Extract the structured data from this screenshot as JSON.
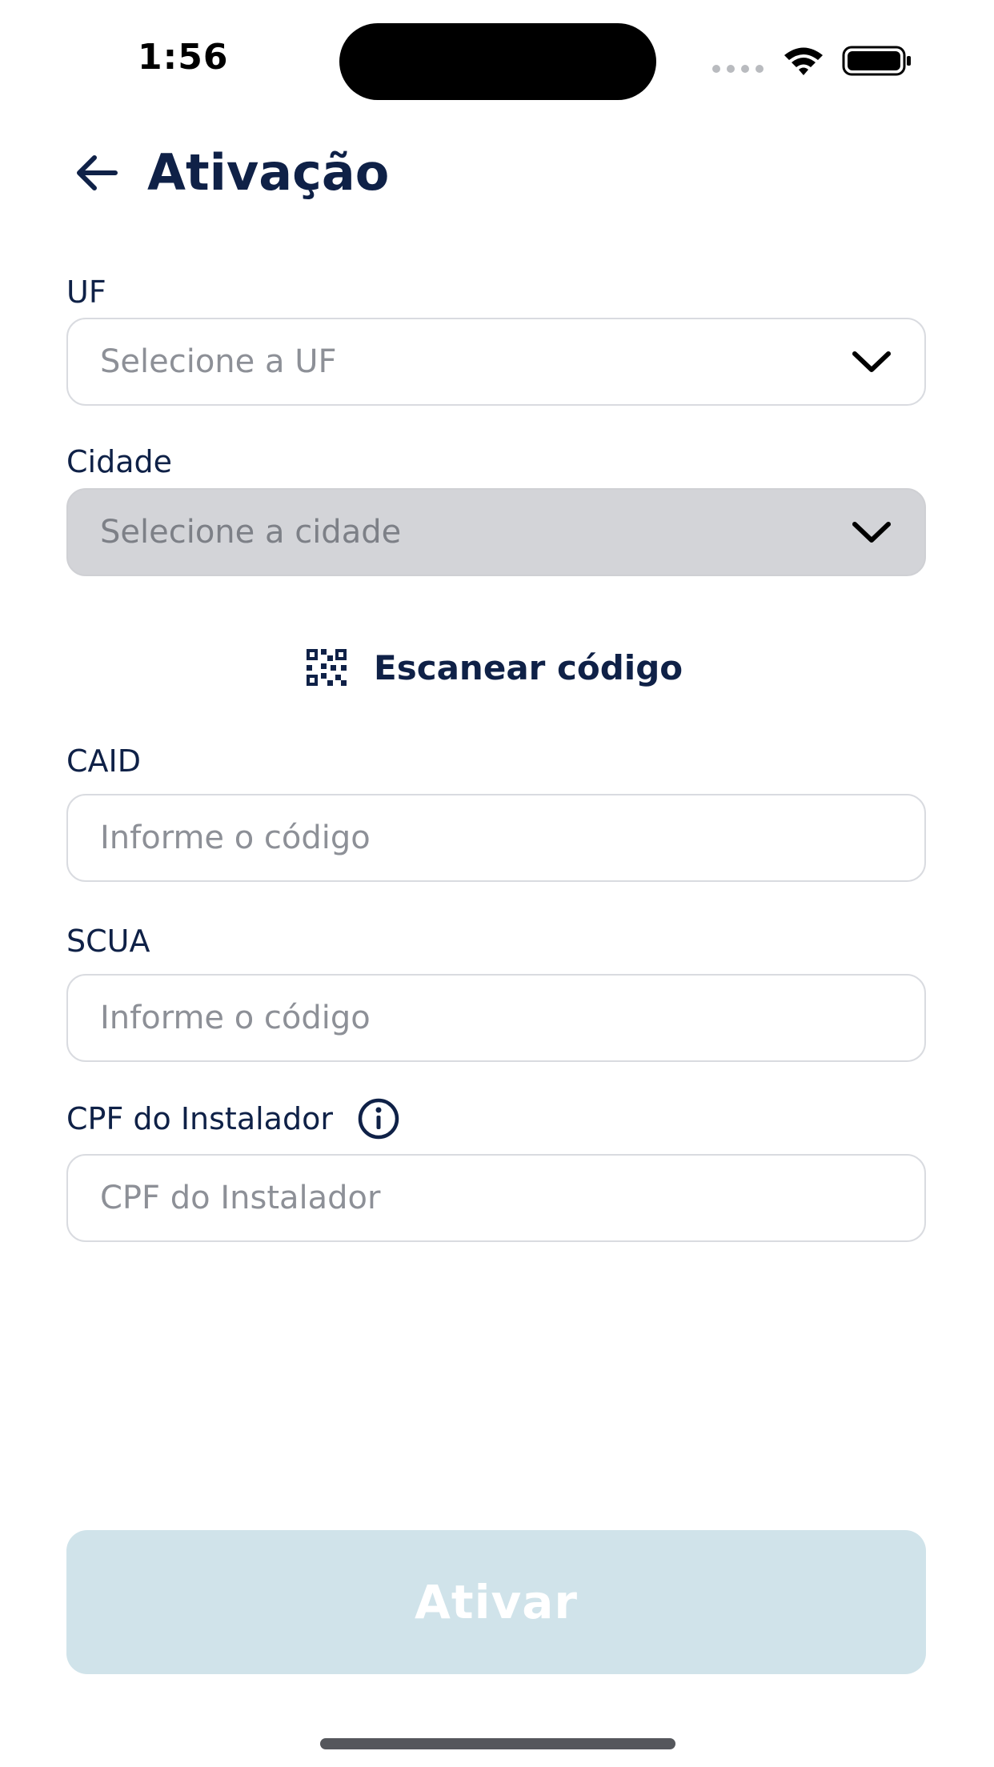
{
  "status_bar": {
    "time": "1:56"
  },
  "header": {
    "title": "Ativação",
    "back_icon": "arrow-left-icon"
  },
  "form": {
    "uf": {
      "label": "UF",
      "placeholder": "Selecione a UF",
      "icon": "chevron-down-icon"
    },
    "cidade": {
      "label": "Cidade",
      "placeholder": "Selecione a cidade",
      "icon": "chevron-down-icon",
      "disabled": true
    },
    "scan": {
      "label": "Escanear código",
      "icon": "qr-code-icon"
    },
    "caid": {
      "label": "CAID",
      "placeholder": "Informe o código"
    },
    "scua": {
      "label": "SCUA",
      "placeholder": "Informe o código"
    },
    "cpf": {
      "label": "CPF do Instalador",
      "placeholder": "CPF do Instalador",
      "info_icon": "info-icon"
    }
  },
  "submit": {
    "label": "Ativar",
    "disabled": true
  },
  "colors": {
    "primary_text": "#0f2147",
    "placeholder": "#8d9097",
    "disabled_field": "#d3d4d8",
    "disabled_button": "#d0e3ea"
  }
}
